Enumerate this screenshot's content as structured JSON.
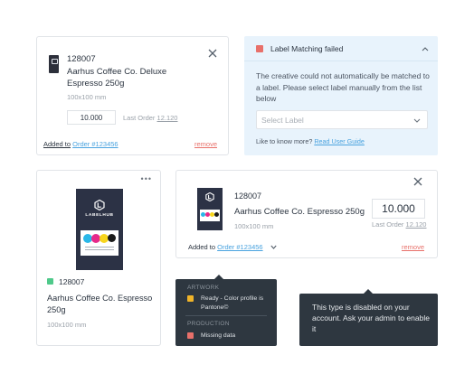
{
  "colors": {
    "accent": "#4aa3df",
    "error": "#e8706a",
    "warning": "#f0b429",
    "ok": "#4fc98a",
    "package": "#2c3245",
    "tooltip": "#2e3740",
    "alert_bg": "#e8f3fc"
  },
  "card1": {
    "sku": "128007",
    "name": "Aarhus Coffee Co. Deluxe Espresso 250g",
    "dims": "100x100 mm",
    "qty": "10.000",
    "last_order_label": "Last Order",
    "last_order_value": "12.120",
    "added_to_label": "Added to",
    "order_link": "Order #123456",
    "remove": "remove",
    "close_icon": "close-icon"
  },
  "alert": {
    "title": "Label Matching failed",
    "message": "The creative could not automatically be matched to a label. Please select label manually from the list below",
    "select_placeholder": "Select Label",
    "more_prefix": "Like to know more?",
    "more_link": "Read User Guide",
    "status_color": "#e8706a"
  },
  "card3": {
    "menu_icon": "more-dots-icon",
    "brand": "LABELHUB",
    "sku": "128007",
    "name": "Aarhus Coffee Co. Espresso 250g",
    "dims": "100x100 mm",
    "status_color": "#4fc98a"
  },
  "card4": {
    "sku": "128007",
    "name": "Aarhus Coffee Co. Espresso 250g",
    "dims": "100x100 mm",
    "qty": "10.000",
    "last_order_label": "Last Order",
    "last_order_value": "12.120",
    "added_to_label": "Added to",
    "order_link": "Order #123456",
    "remove": "remove"
  },
  "tooltip_status": {
    "artwork_header": "ARTWORK",
    "artwork_text": "Ready - Color profile is Pantone©",
    "production_header": "PRODUCTION",
    "production_text": "Missing data"
  },
  "tooltip_disabled": {
    "text": "This type is disabled on your account. Ask your admin to enable it"
  }
}
